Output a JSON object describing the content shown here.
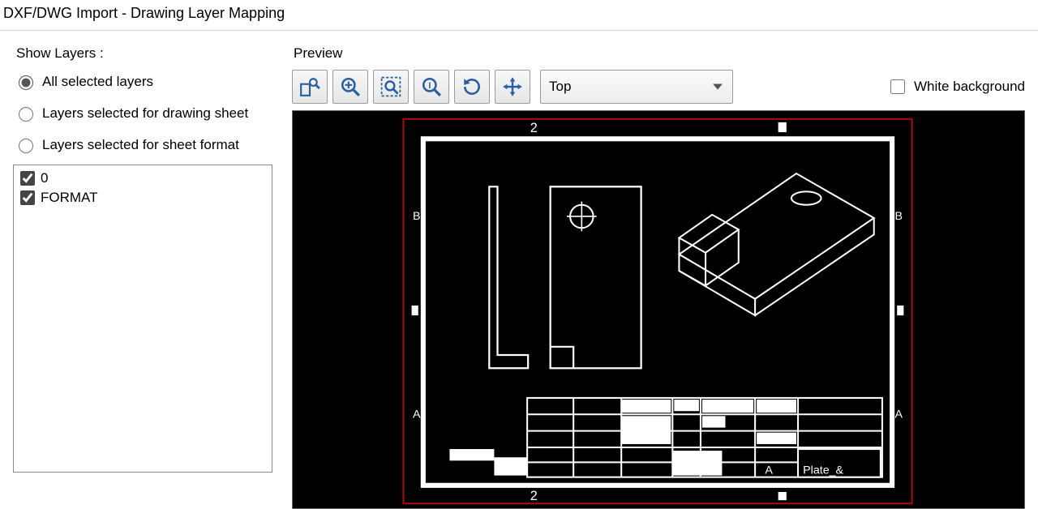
{
  "window": {
    "title": "DXF/DWG Import - Drawing Layer Mapping"
  },
  "show_layers": {
    "group_label": "Show Layers :",
    "options": [
      {
        "label": "All selected layers",
        "selected": true
      },
      {
        "label": "Layers selected for drawing sheet",
        "selected": false
      },
      {
        "label": "Layers selected for sheet format",
        "selected": false
      }
    ]
  },
  "layer_list": [
    {
      "name": "0",
      "checked": true
    },
    {
      "name": "FORMAT",
      "checked": true
    }
  ],
  "preview": {
    "label": "Preview",
    "view_dropdown": {
      "value": "Top"
    },
    "white_background": {
      "label": "White background",
      "checked": false
    },
    "ruler_top": "2",
    "ruler_bottom": "2",
    "letter_left_top": "B",
    "letter_right_top": "B",
    "letter_left_bottom": "A",
    "letter_right_bottom": "A",
    "titleblock_label_a": "A",
    "titleblock_text": "Plate_&"
  },
  "icons": {
    "zoom_area": "zoom-area-icon",
    "zoom_in": "zoom-in-icon",
    "zoom_window": "zoom-window-icon",
    "zoom_fit": "zoom-fit-icon",
    "refresh": "refresh-icon",
    "pan": "pan-icon"
  }
}
